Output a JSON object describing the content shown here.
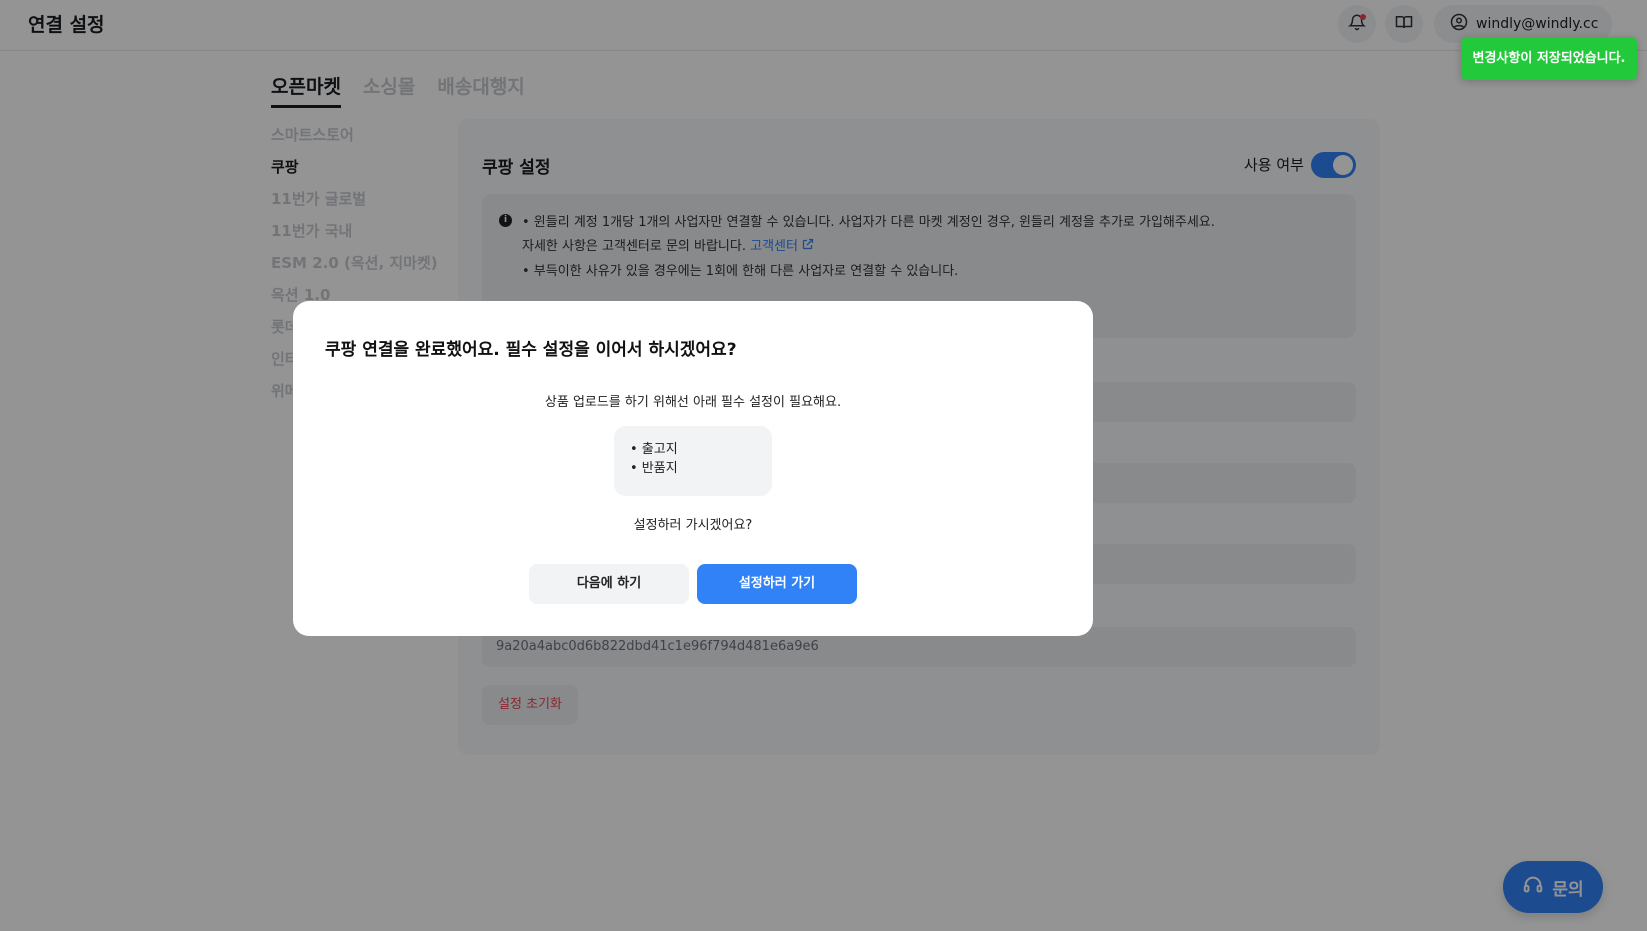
{
  "header": {
    "title": "연결 설정",
    "account_email": "windly@windly.cc",
    "bell_icon": "bell-icon",
    "book_icon": "book-icon",
    "user_icon": "user-circle-icon"
  },
  "main_tabs": [
    {
      "label": "오픈마켓",
      "active": true
    },
    {
      "label": "소싱몰",
      "active": false
    },
    {
      "label": "배송대행지",
      "active": false
    }
  ],
  "side_menu": [
    {
      "label": "스마트스토어",
      "active": false
    },
    {
      "label": "쿠팡",
      "active": true
    },
    {
      "label": "11번가 글로벌",
      "active": false
    },
    {
      "label": "11번가 국내",
      "active": false
    },
    {
      "label": "ESM 2.0 (옥션, 지마켓)",
      "active": false
    },
    {
      "label": "옥션 1.0",
      "active": false
    },
    {
      "label": "롯데",
      "active": false
    },
    {
      "label": "인터",
      "active": false
    },
    {
      "label": "위메",
      "active": false
    }
  ],
  "panel": {
    "title": "쿠팡 설정",
    "toggle_label": "사용 여부",
    "toggle_on": true,
    "notice": {
      "line1": "• 윈들리 계정 1개당 1개의 사업자만 연결할 수 있습니다. 사업자가 다른 마켓 계정인 경우, 윈들리 계정을 추가로 가입해주세요.",
      "line2": "자세한 사항은 고객센터로 문의 바랍니다.",
      "link": "고객센터",
      "line3": "• 부득이한 사유가 있을 경우에는 1회에 한해 다른 사업자로 연결할 수 있습니다."
    },
    "secret_value": "9a20a4abc0d6b822dbd41c1e96f794d481e6a9e6",
    "reset_label": "설정 초기화"
  },
  "toast": {
    "message": "변경사항이 저장되었습니다."
  },
  "modal": {
    "title": "쿠팡 연결을 완료했어요. 필수 설정을 이어서 하시겠어요?",
    "description": "상품 업로드를 하기 위해선 아래 필수 설정이 필요해요.",
    "required_items": [
      "• 출고지",
      "• 반품지"
    ],
    "question": "설정하러 가시겠어요?",
    "later_label": "다음에 하기",
    "go_label": "설정하러 가기"
  },
  "chat": {
    "label": "문의",
    "icon": "headset-icon"
  },
  "colors": {
    "accent": "#3182f6",
    "toast": "#22c93a",
    "danger": "#f04452"
  }
}
